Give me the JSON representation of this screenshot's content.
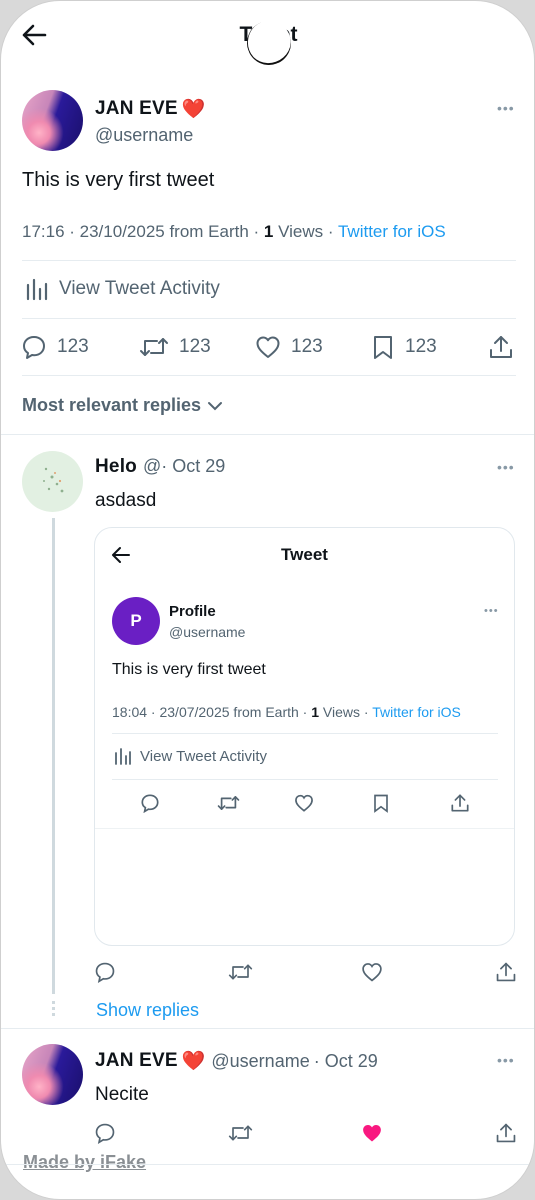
{
  "header": {
    "title": "Tweet",
    "back_icon": "back-arrow-icon"
  },
  "main_tweet": {
    "name": "JAN EVE",
    "heart": "❤️",
    "handle": "@username",
    "text": "This is very first tweet",
    "time": "17:16 · 23/10/2025 from Earth · ",
    "views_count": "1",
    "views_label": " Views · ",
    "source": "Twitter for iOS",
    "activity_label": "View Tweet Activity",
    "stats": {
      "replies": "123",
      "retweets": "123",
      "likes": "123",
      "bookmarks": "123"
    }
  },
  "replies_sort": {
    "label": "Most relevant replies"
  },
  "reply_1": {
    "name": "Helo",
    "handle": "@",
    "date": " · Oct 29",
    "text": "asdasd",
    "embed": {
      "title": "Tweet",
      "name": "Profile",
      "avatar_letter": "P",
      "handle": "@username",
      "text": "This is very first tweet",
      "time": "18:04 · 23/07/2025 from Earth · ",
      "views_count": "1",
      "views_label": " Views · ",
      "source": "Twitter for iOS",
      "activity_label": "View Tweet Activity"
    },
    "show_replies": "Show replies"
  },
  "reply_2": {
    "name": "JAN EVE",
    "heart": "❤️",
    "handle": "@username",
    "date": " · Oct 29",
    "text": "Necite",
    "liked_color": "#f91880"
  },
  "footer": {
    "watermark": "Made by iFake"
  },
  "colors": {
    "accent": "#1d9bf0",
    "secondary_text": "#536471",
    "like": "#f91880"
  }
}
